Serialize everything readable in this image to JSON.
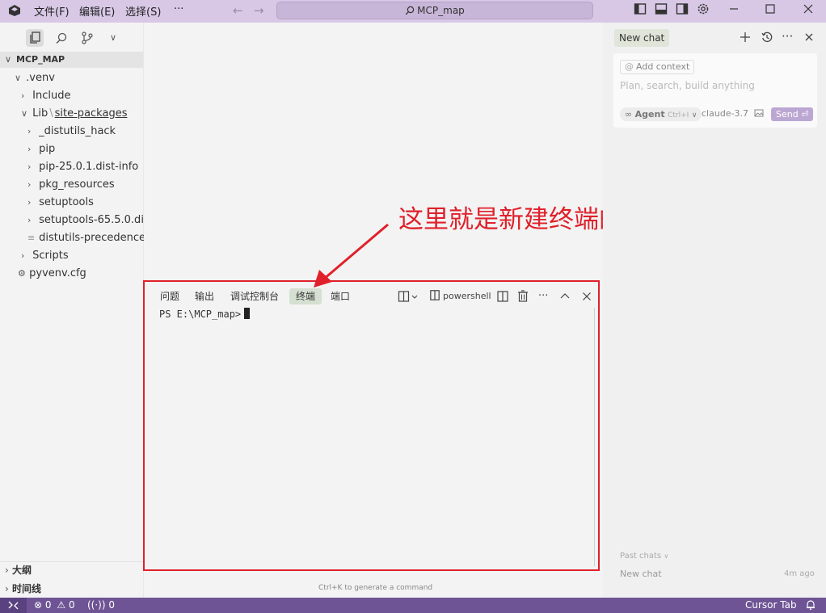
{
  "titlebar": {
    "menus": [
      "文件(F)",
      "编辑(E)",
      "选择(S)",
      "···"
    ],
    "search_text": "MCP_map",
    "back_glyph": "←",
    "forward_glyph": "→"
  },
  "explorer": {
    "project_name": "MCP_MAP",
    "tree": [
      {
        "chev": "∨",
        "label": ".venv"
      },
      {
        "chev": "›",
        "label": "Include"
      },
      {
        "chev": "∨",
        "label": "Lib",
        "sep": "\\",
        "label2": "site-packages"
      },
      {
        "chev": "›",
        "label": "_distutils_hack"
      },
      {
        "chev": "›",
        "label": "pip"
      },
      {
        "chev": "›",
        "label": "pip-25.0.1.dist-info"
      },
      {
        "chev": "›",
        "label": "pkg_resources"
      },
      {
        "chev": "›",
        "label": "setuptools"
      },
      {
        "chev": "›",
        "label": "setuptools-65.5.0.di..."
      },
      {
        "chev": "≡",
        "label": "distutils-precedence..."
      },
      {
        "chev": "›",
        "label": "Scripts"
      },
      {
        "chev": "⚙",
        "label": "pyvenv.cfg"
      }
    ],
    "sections": [
      "大纲",
      "时间线"
    ]
  },
  "panel": {
    "tabs": [
      "问题",
      "输出",
      "调试控制台",
      "终端",
      "端口"
    ],
    "active_tab": "终端",
    "shell_name": "powershell",
    "prompt": "PS E:\\MCP_map>"
  },
  "editor": {
    "hint": "Ctrl+K to generate a command"
  },
  "annotation": {
    "text": "这里就是新建终端的窗口了",
    "color": "#e0202a"
  },
  "chat": {
    "tab_label": "New chat",
    "add_context": "Add context",
    "placeholder": "Plan, search, build anything",
    "agent_label": "Agent",
    "agent_shortcut": "Ctrl+I",
    "model": "claude-3.7",
    "send_label": "Send",
    "past_chats_label": "Past chats",
    "past_items": [
      {
        "title": "New chat",
        "time": "4m ago"
      }
    ]
  },
  "statusbar": {
    "errors": "0",
    "warnings": "0",
    "ports": "0",
    "right_label": "Cursor Tab",
    "bg_color": "#6e5494"
  }
}
